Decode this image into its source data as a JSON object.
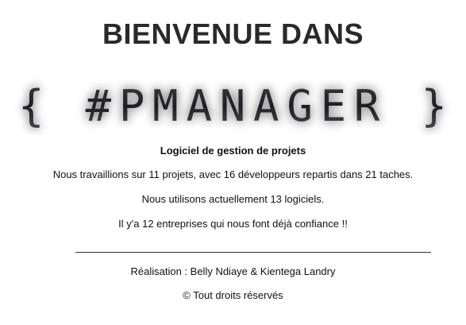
{
  "welcome_title": "BIENVENUE DANS",
  "logo": {
    "text": "{ #PMANAGER }",
    "color": "#2c2c30",
    "glow_color": "#8a8a8a"
  },
  "tagline": "Logiciel de gestion de projets",
  "stats": {
    "line1": "Nous travaillions sur 11 projets, avec 16 développeurs repartis dans 21 taches.",
    "line2": "Nous utilisons actuellement 13 logiciels.",
    "line3": "Il y'a 12 entreprises qui nous font déjà confiance !!"
  },
  "footer": {
    "credits": "Réalisation : Belly Ndiaye & Kientega Landry",
    "copyright": "© Tout droits réservés"
  }
}
